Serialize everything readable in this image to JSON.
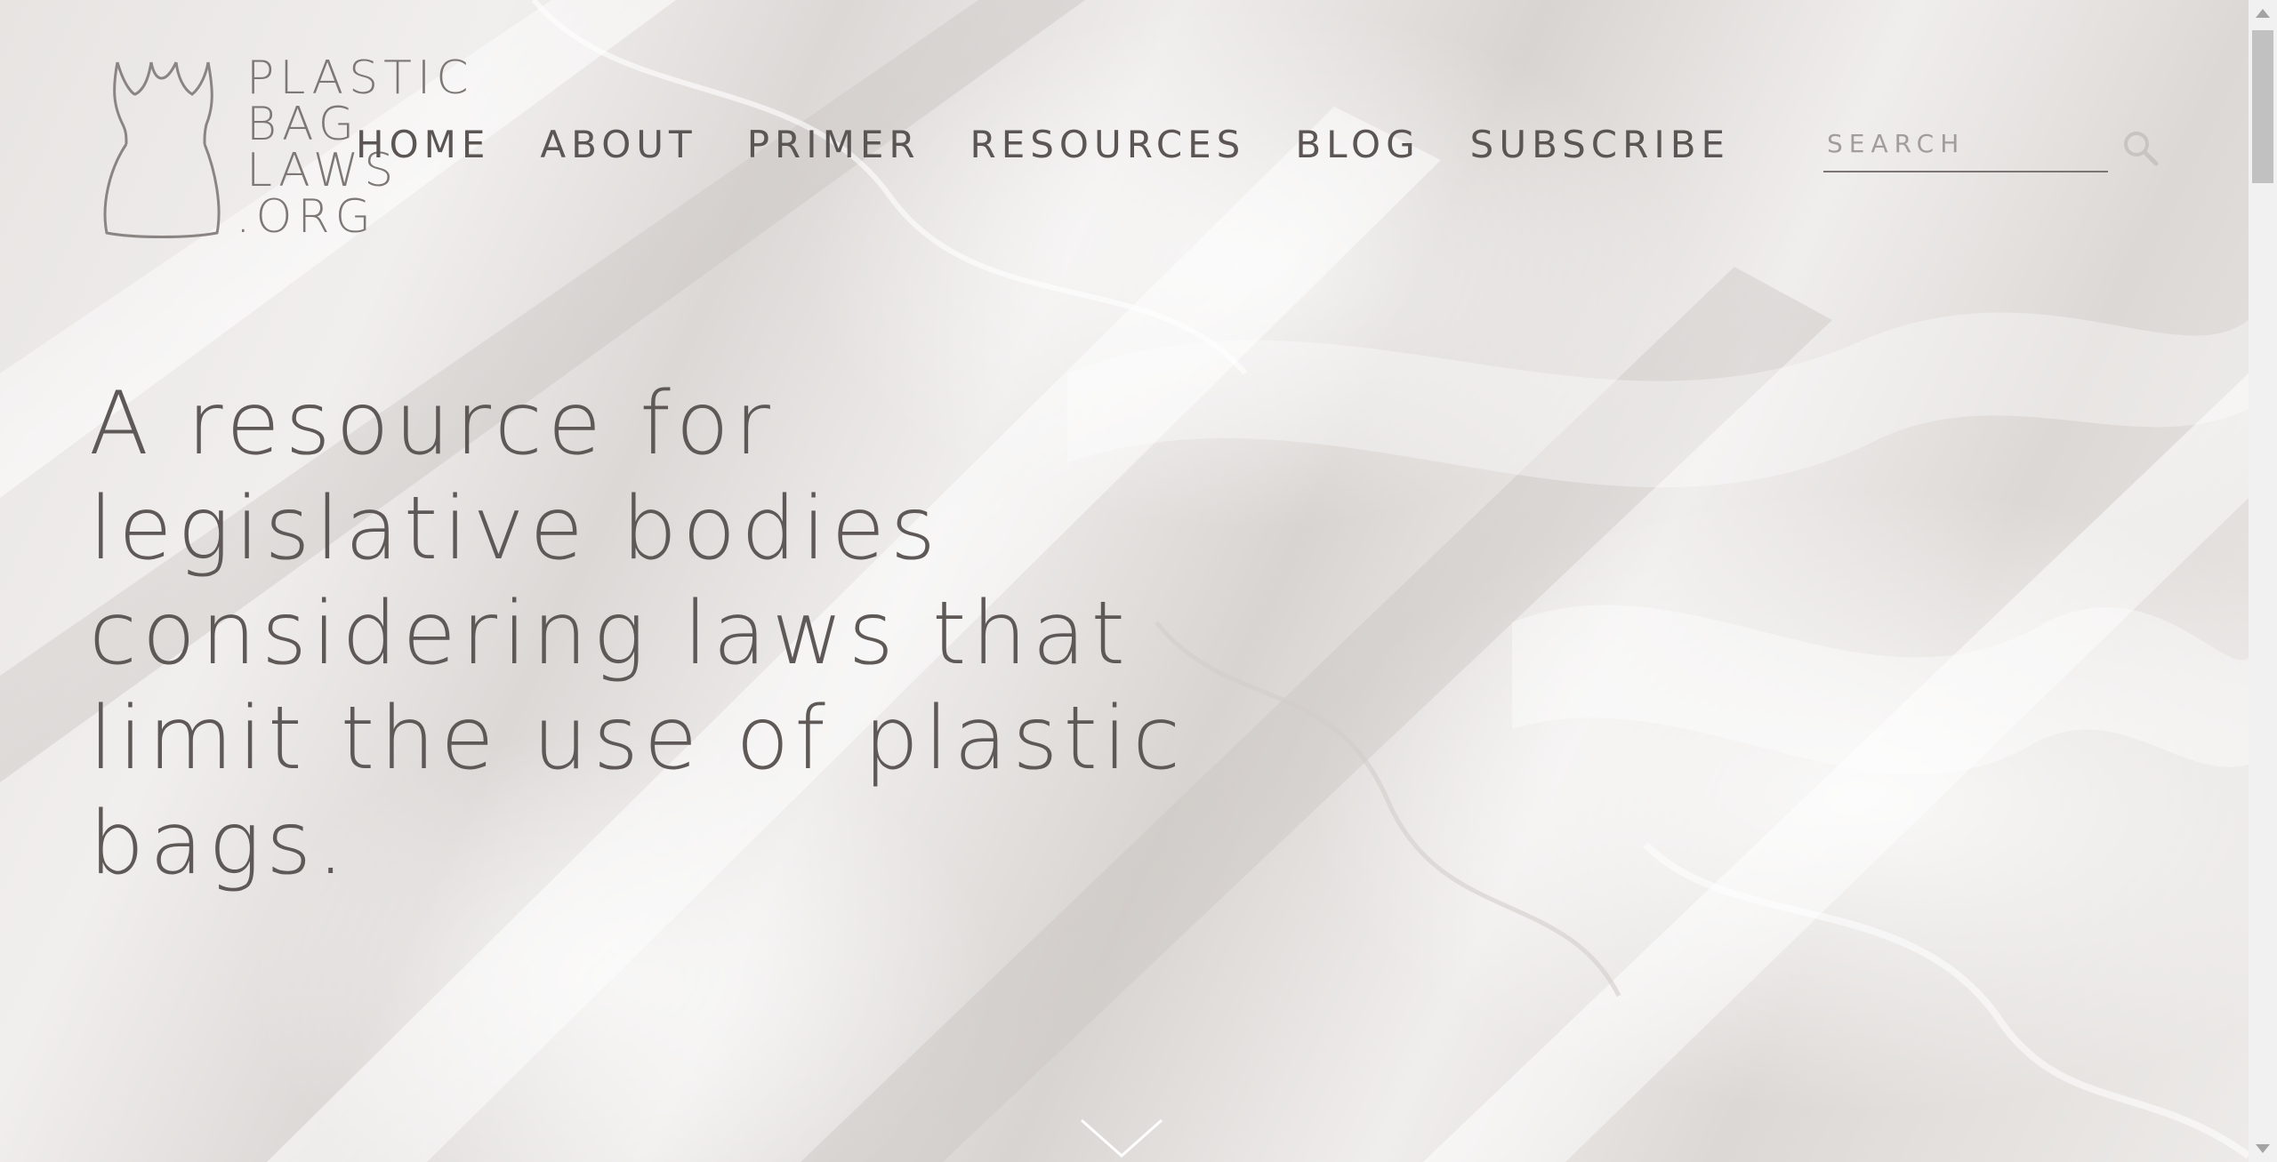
{
  "logo": {
    "lines": [
      "PLASTIC",
      "BAG",
      "LAWS",
      ".ORG"
    ]
  },
  "nav": {
    "items": [
      {
        "label": "HOME"
      },
      {
        "label": "ABOUT"
      },
      {
        "label": "PRIMER"
      },
      {
        "label": "RESOURCES"
      },
      {
        "label": "BLOG"
      },
      {
        "label": "SUBSCRIBE"
      }
    ]
  },
  "search": {
    "placeholder": "SEARCH",
    "value": ""
  },
  "hero": {
    "lines": [
      "A resource for",
      "legislative bodies",
      "considering laws that",
      "limit the use of plastic",
      "bags."
    ]
  },
  "icons": {
    "logo": "plastic-bag-icon",
    "search": "search-icon",
    "scroll": "chevron-down-icon"
  },
  "colors": {
    "text": "#5e5856",
    "logo": "#7d7775",
    "background": "#e9e6e4"
  }
}
